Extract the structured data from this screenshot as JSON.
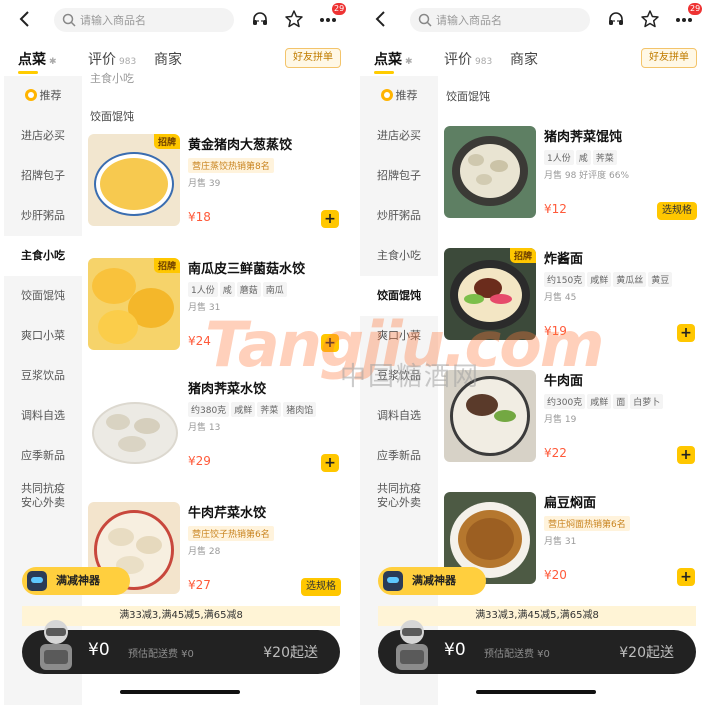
{
  "screens": [
    {
      "search": {
        "placeholder": "请输入商品名"
      },
      "badge": "29",
      "tabs": [
        {
          "label": "点菜",
          "sub": ""
        },
        {
          "label": "评价",
          "sub": "983"
        },
        {
          "label": "商家",
          "sub": ""
        }
      ],
      "group_button": "好友拼单",
      "sidebar": [
        {
          "label": "推荐"
        },
        {
          "label": "进店必买"
        },
        {
          "label": "招牌包子"
        },
        {
          "label": "炒肝粥品"
        },
        {
          "label": "主食小吃"
        },
        {
          "label": "饺面馄饨"
        },
        {
          "label": "爽口小菜"
        },
        {
          "label": "豆浆饮品"
        },
        {
          "label": "调料自选"
        },
        {
          "label": "应季新品"
        },
        {
          "label": "共同抗疫\n安心外卖"
        }
      ],
      "cut_title": "主食小吃",
      "category_title": "饺面馄饨",
      "items": [
        {
          "name": "黄金猪肉大葱蒸饺",
          "flag": "招牌",
          "rank": "营庄蒸饺热销第8名",
          "tags": [],
          "sales": "月售 39",
          "price": "¥18",
          "action": "+"
        },
        {
          "name": "南瓜皮三鲜菌菇水饺",
          "flag": "招牌",
          "rank": "",
          "tags": [
            "1人份",
            "咸",
            "蘑菇",
            "南瓜"
          ],
          "sales": "月售 31",
          "price": "¥24",
          "action": "+"
        },
        {
          "name": "猪肉荠菜水饺",
          "flag": "",
          "rank": "",
          "tags": [
            "约380克",
            "咸鲜",
            "荠菜",
            "猪肉馅"
          ],
          "sales": "月售 13",
          "price": "¥29",
          "action": "+"
        },
        {
          "name": "牛肉芹菜水饺",
          "flag": "",
          "rank": "营庄饺子热销第6名",
          "tags": [],
          "sales": "月售 28",
          "price": "¥27",
          "action": "选规格"
        }
      ],
      "promo_button": "满减神器",
      "discount_strip": "满33减3,满45减5,满65减8",
      "cart": {
        "amount": "¥0",
        "delivery": "预估配送费 ¥0",
        "min_order": "¥20起送"
      }
    },
    {
      "search": {
        "placeholder": "请输入商品名"
      },
      "badge": "29",
      "tabs": [
        {
          "label": "点菜",
          "sub": ""
        },
        {
          "label": "评价",
          "sub": "983"
        },
        {
          "label": "商家",
          "sub": ""
        }
      ],
      "group_button": "好友拼单",
      "sidebar": [
        {
          "label": "推荐"
        },
        {
          "label": "进店必买"
        },
        {
          "label": "招牌包子"
        },
        {
          "label": "炒肝粥品"
        },
        {
          "label": "主食小吃"
        },
        {
          "label": "饺面馄饨"
        },
        {
          "label": "爽口小菜"
        },
        {
          "label": "豆浆饮品"
        },
        {
          "label": "调料自选"
        },
        {
          "label": "应季新品"
        },
        {
          "label": "共同抗疫\n安心外卖"
        }
      ],
      "category_title": "饺面馄饨",
      "items": [
        {
          "name": "猪肉荠菜馄饨",
          "flag": "",
          "rank": "",
          "tags": [
            "1人份",
            "咸",
            "荠菜"
          ],
          "sales": "月售 98  好评度 66%",
          "price": "¥12",
          "action": "选规格"
        },
        {
          "name": "炸酱面",
          "flag": "招牌",
          "rank": "",
          "tags": [
            "约150克",
            "咸鲜",
            "黄瓜丝",
            "黄豆"
          ],
          "sales": "月售 45",
          "price": "¥19",
          "action": "+"
        },
        {
          "name": "牛肉面",
          "flag": "",
          "rank": "",
          "tags": [
            "约300克",
            "咸鲜",
            "面",
            "白萝卜"
          ],
          "sales": "月售 19",
          "price": "¥22",
          "action": "+"
        },
        {
          "name": "扁豆焖面",
          "flag": "",
          "rank": "营庄焖面热销第6名",
          "tags": [],
          "sales": "月售 31",
          "price": "¥20",
          "action": "+"
        }
      ],
      "promo_button": "满减神器",
      "discount_strip": "满33减3,满45减5,满65减8",
      "cart": {
        "amount": "¥0",
        "delivery": "预估配送费 ¥0",
        "min_order": "¥20起送"
      }
    }
  ],
  "watermark": {
    "text": "Tangjiu.com",
    "text_cn": "中国糖酒网"
  },
  "colors": {
    "accent": "#ffc700",
    "price": "#ff5a3a",
    "cart_bar": "#222222",
    "rank_text": "#c8831e"
  },
  "icons": [
    "back-icon",
    "search-icon",
    "customer-service-icon",
    "star-icon",
    "more-icon",
    "cart-mascot-icon",
    "plus-icon"
  ]
}
